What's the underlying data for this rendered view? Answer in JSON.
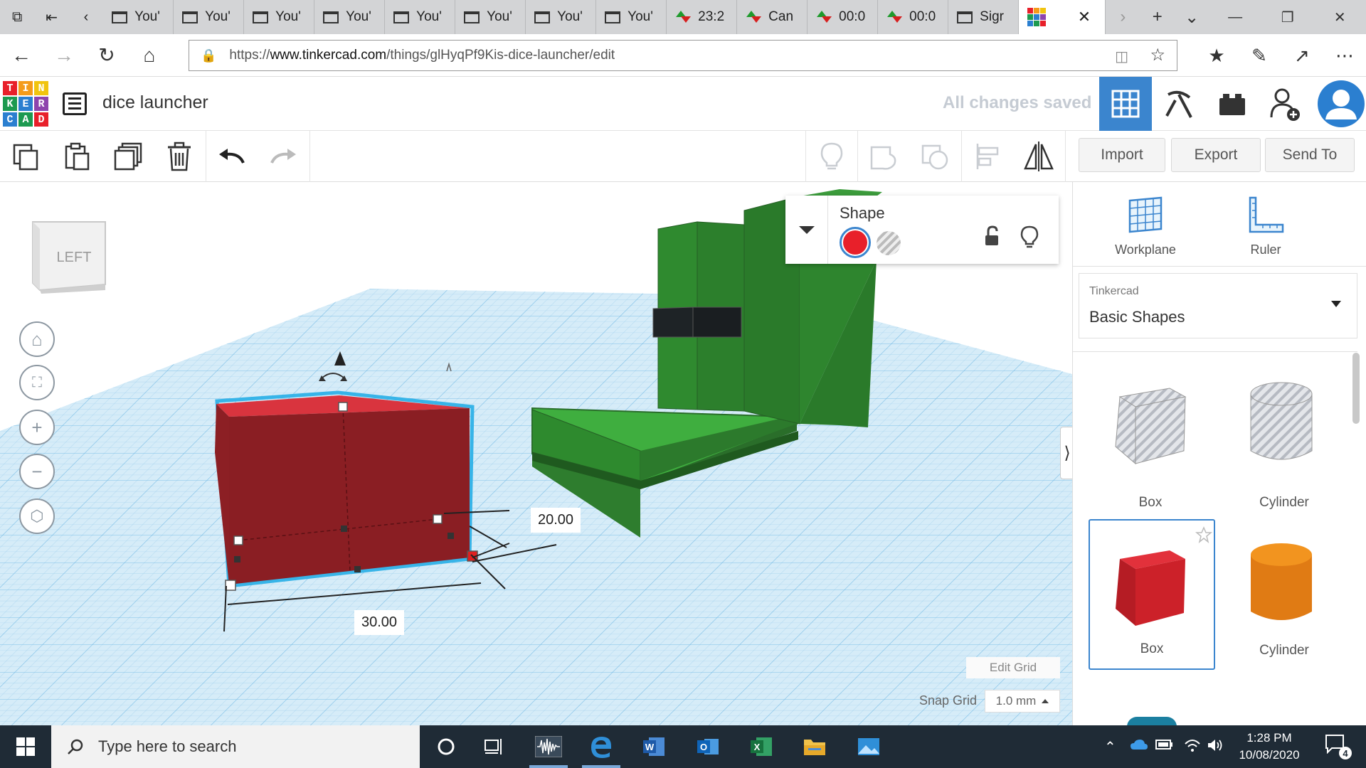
{
  "browser": {
    "tabs": [
      {
        "label": "You'",
        "icon": "window-icon"
      },
      {
        "label": "You'",
        "icon": "window-icon"
      },
      {
        "label": "You'",
        "icon": "window-icon"
      },
      {
        "label": "You'",
        "icon": "window-icon"
      },
      {
        "label": "You'",
        "icon": "window-icon"
      },
      {
        "label": "You'",
        "icon": "window-icon"
      },
      {
        "label": "You'",
        "icon": "window-icon"
      },
      {
        "label": "You'",
        "icon": "window-icon"
      },
      {
        "label": "23:2",
        "icon": "stock-icon"
      },
      {
        "label": "Can",
        "icon": "stock-icon"
      },
      {
        "label": "00:0",
        "icon": "stock-icon"
      },
      {
        "label": "00:0",
        "icon": "stock-icon"
      },
      {
        "label": "Sigr",
        "icon": "window-icon"
      }
    ],
    "url_prefix": "https://",
    "url_domain": "www.tinkercad.com",
    "url_path": "/things/glHyqPf9Kis-dice-launcher/edit"
  },
  "app": {
    "logo_letters": [
      "T",
      "I",
      "N",
      "K",
      "E",
      "R",
      "C",
      "A",
      "D"
    ],
    "logo_colors": [
      "#e8202a",
      "#f49b1a",
      "#f1c40f",
      "#1d9a50",
      "#2b7fd0",
      "#8e44ad",
      "#2b7fd0",
      "#1d9a50",
      "#e8202a"
    ],
    "design_title": "dice launcher",
    "save_status": "All changes saved"
  },
  "toolbar": {
    "import_label": "Import",
    "export_label": "Export",
    "send_to_label": "Send To"
  },
  "workspace": {
    "view_cube_face": "LEFT",
    "dimension_width": "30.00",
    "dimension_depth": "20.00",
    "inspector_title": "Shape",
    "shape_color": "#e8202a",
    "edit_grid_label": "Edit Grid",
    "snap_grid_label": "Snap Grid",
    "snap_grid_value": "1.0 mm"
  },
  "right_panel": {
    "workplane_label": "Workplane",
    "ruler_label": "Ruler",
    "library_category": "Tinkercad",
    "library_name": "Basic Shapes",
    "shapes": [
      {
        "label": "Box",
        "style": "hole"
      },
      {
        "label": "Cylinder",
        "style": "hole"
      },
      {
        "label": "Box",
        "style": "solid-red",
        "selected": true
      },
      {
        "label": "Cylinder",
        "style": "solid-orange"
      }
    ]
  },
  "taskbar": {
    "search_placeholder": "Type here to search",
    "time": "1:28 PM",
    "date": "10/08/2020",
    "notification_count": "4"
  }
}
